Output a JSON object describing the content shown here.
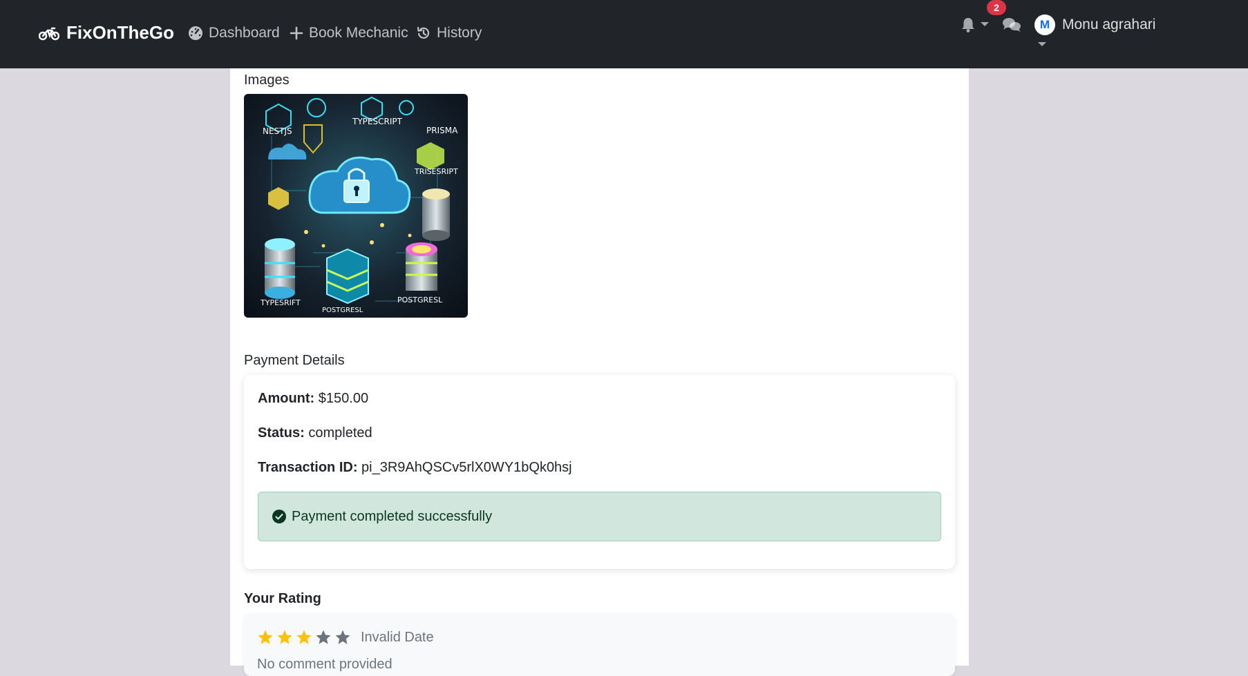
{
  "nav": {
    "brand": "FixOnTheGo",
    "dashboard": "Dashboard",
    "book": "Book Mechanic",
    "history": "History",
    "notification_count": "2",
    "avatar_letter": "M",
    "username": "Monu agrahari"
  },
  "images": {
    "label": "Images",
    "thumb_texts": [
      "NESTJS",
      "TYPESCRIPT",
      "PRISMA",
      "TRISESRIPT",
      "TYPESRIFT",
      "POSTGRESL",
      "POSTGRESL"
    ]
  },
  "payment": {
    "title": "Payment Details",
    "amount_label": "Amount:",
    "amount": "$150.00",
    "status_label": "Status:",
    "status": "completed",
    "txn_label": "Transaction ID:",
    "txn": "pi_3R9AhQSCv5rlX0WY1bQk0hsj",
    "success": "Payment completed successfully"
  },
  "rating": {
    "title": "Your Rating",
    "stars": 3,
    "max": 5,
    "date": "Invalid Date",
    "comment": "No comment provided"
  },
  "colors": {
    "navbar": "#212529",
    "star_filled": "#ffc107",
    "star_empty": "#6c757d",
    "alert_bg": "#d1e7dd",
    "badge": "#dc3545"
  }
}
